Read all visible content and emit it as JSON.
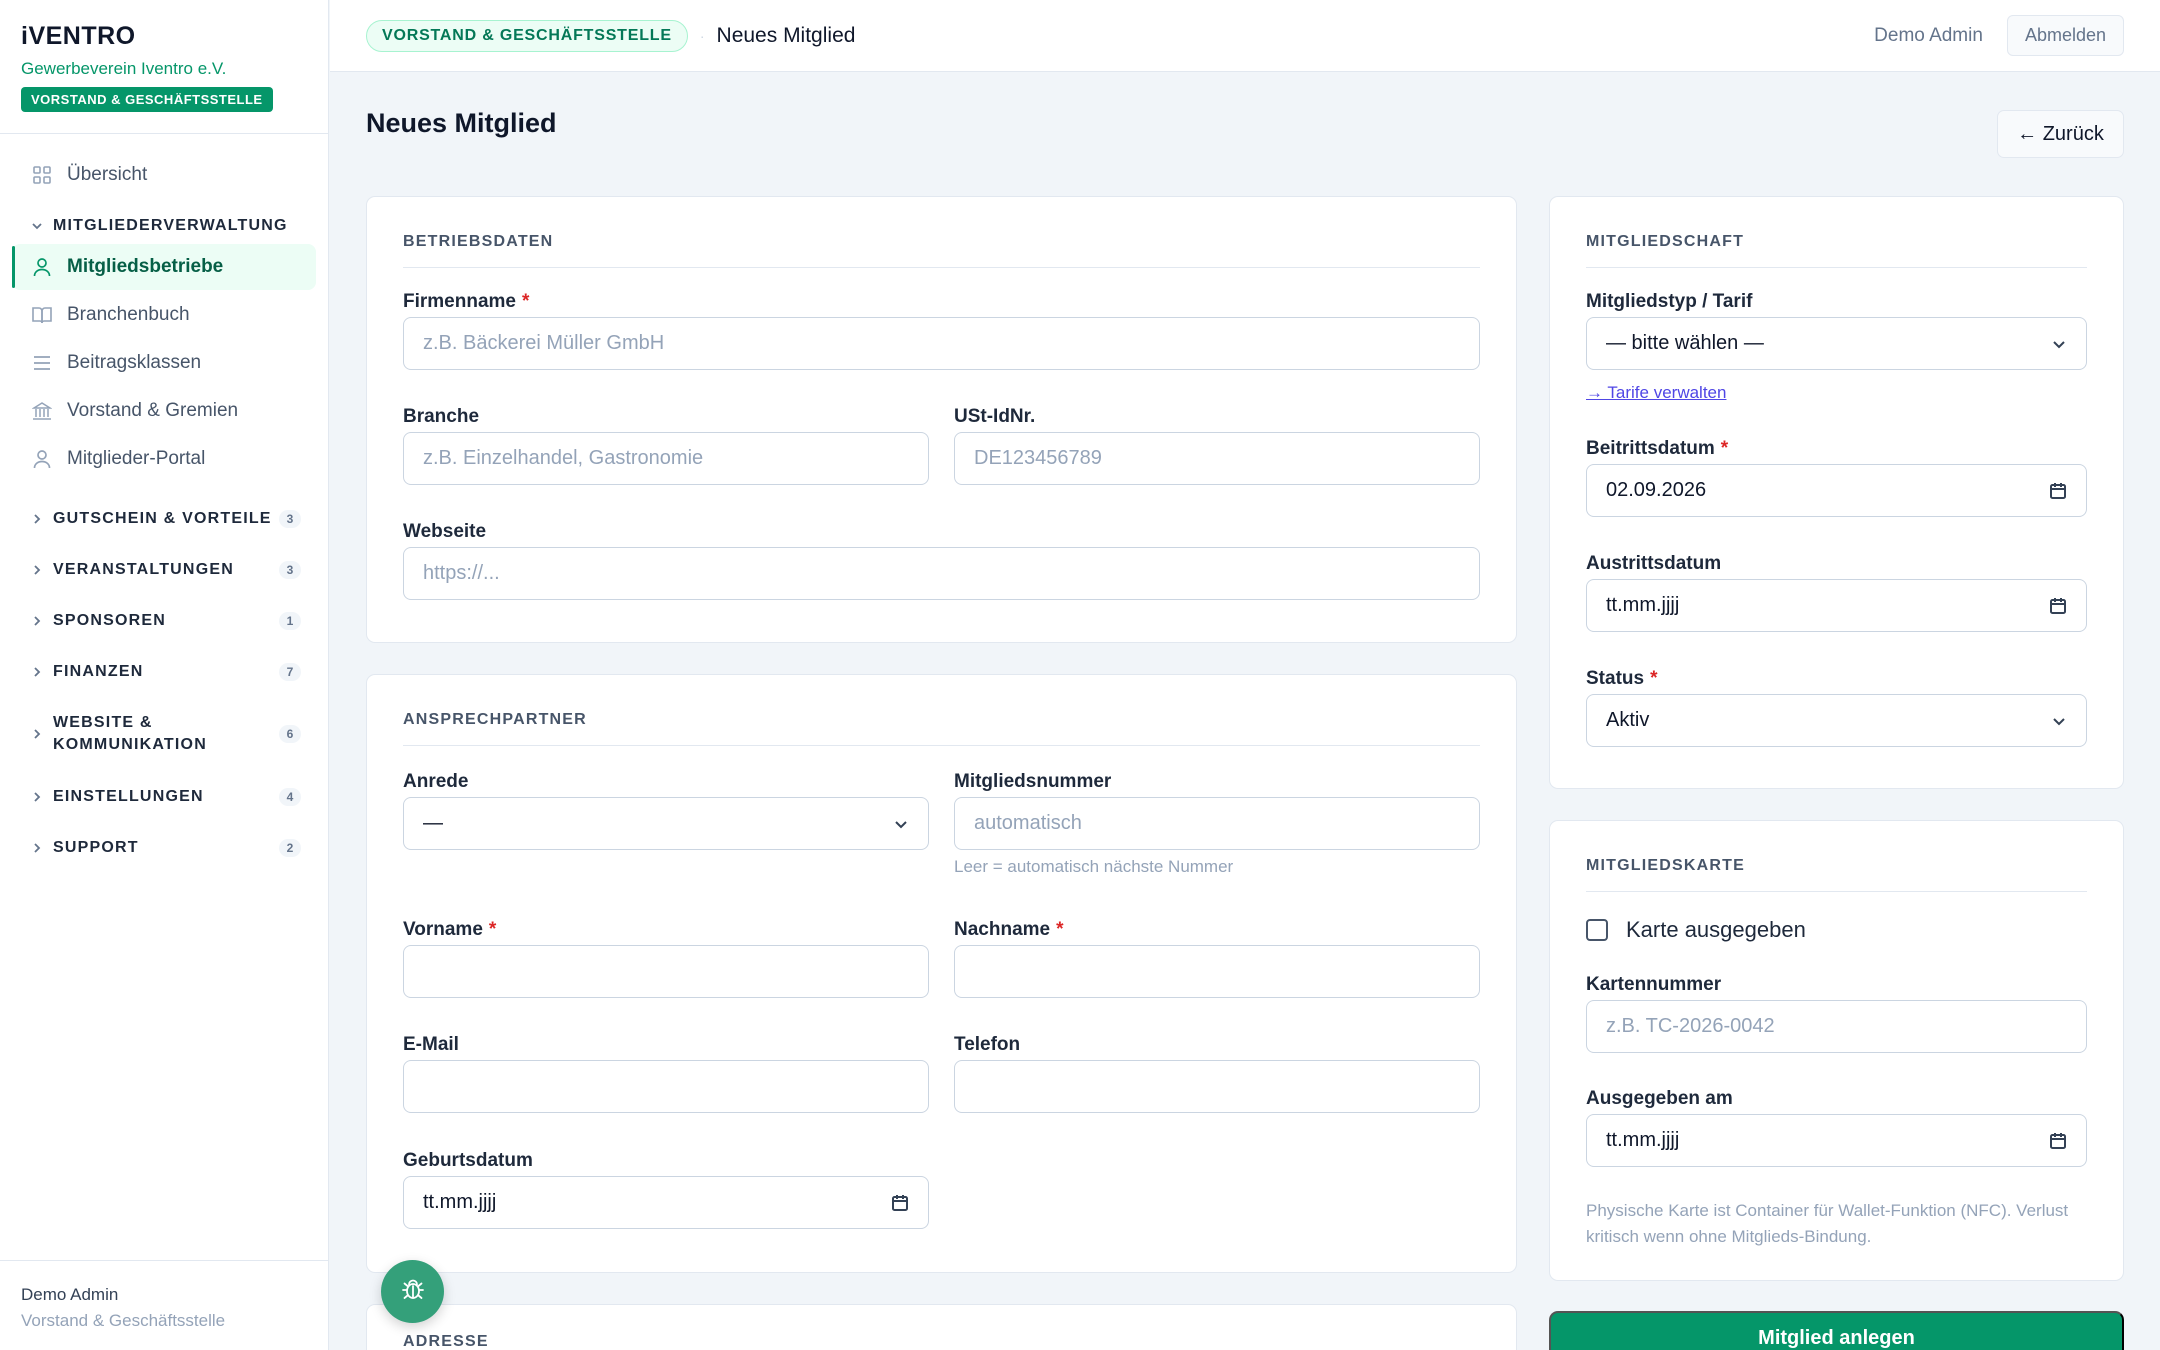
{
  "brand": {
    "logo": "iVENTRO",
    "org": "Gewerbeverein Iventro e.V.",
    "role_badge": "VORSTAND & GESCHÄFTSSTELLE"
  },
  "sidebar": {
    "items": [
      {
        "label": "Übersicht",
        "icon": "grid-icon"
      },
      {
        "label": "Mitgliedsbetriebe",
        "icon": "user-icon"
      },
      {
        "label": "Branchenbuch",
        "icon": "book-icon"
      },
      {
        "label": "Beitragsklassen",
        "icon": "list-icon"
      },
      {
        "label": "Vorstand & Gremien",
        "icon": "building-icon"
      },
      {
        "label": "Mitglieder-Portal",
        "icon": "user-icon"
      }
    ],
    "expanded_group": "MITGLIEDERVERWALTUNG",
    "groups": [
      {
        "label": "GUTSCHEIN & VORTEILE",
        "count": "3"
      },
      {
        "label": "VERANSTALTUNGEN",
        "count": "3"
      },
      {
        "label": "SPONSOREN",
        "count": "1"
      },
      {
        "label": "FINANZEN",
        "count": "7"
      },
      {
        "label": "WEBSITE & KOMMUNIKATION",
        "count": "6"
      },
      {
        "label": "EINSTELLUNGEN",
        "count": "4"
      },
      {
        "label": "SUPPORT",
        "count": "2"
      }
    ],
    "footer": {
      "user": "Demo Admin",
      "role": "Vorstand & Geschäftsstelle"
    }
  },
  "topbar": {
    "badge": "VORSTAND & GESCHÄFTSSTELLE",
    "separator": "·",
    "page": "Neues Mitglied",
    "user": "Demo Admin",
    "logout": "Abmelden"
  },
  "page": {
    "title": "Neues Mitglied",
    "back": "← Zurück"
  },
  "betriebsdaten": {
    "title": "BETRIEBSDATEN",
    "firmenname": {
      "label": "Firmenname",
      "placeholder": "z.B. Bäckerei Müller GmbH",
      "required": "*"
    },
    "branche": {
      "label": "Branche",
      "placeholder": "z.B. Einzelhandel, Gastronomie"
    },
    "ustid": {
      "label": "USt-IdNr.",
      "placeholder": "DE123456789"
    },
    "webseite": {
      "label": "Webseite",
      "placeholder": "https://..."
    }
  },
  "ansprechpartner": {
    "title": "ANSPRECHPARTNER",
    "anrede": {
      "label": "Anrede",
      "value": "—"
    },
    "mitgliedsnummer": {
      "label": "Mitgliedsnummer",
      "placeholder": "automatisch",
      "hint": "Leer = automatisch nächste Nummer"
    },
    "vorname": {
      "label": "Vorname",
      "required": "*"
    },
    "nachname": {
      "label": "Nachname",
      "required": "*"
    },
    "email": {
      "label": "E-Mail"
    },
    "telefon": {
      "label": "Telefon"
    },
    "geburtsdatum": {
      "label": "Geburtsdatum",
      "value": "tt.mm.jjjj"
    }
  },
  "adresse": {
    "title": "ADRESSE"
  },
  "mitgliedschaft": {
    "title": "MITGLIEDSCHAFT",
    "tarif": {
      "label": "Mitgliedstyp / Tarif",
      "value": "— bitte wählen —",
      "link": "→ Tarife verwalten"
    },
    "beitritt": {
      "label": "Beitrittsdatum",
      "value": "02.09.2026",
      "required": "*"
    },
    "austritt": {
      "label": "Austrittsdatum",
      "value": "tt.mm.jjjj"
    },
    "status": {
      "label": "Status",
      "value": "Aktiv",
      "required": "*"
    }
  },
  "mitgliedskarte": {
    "title": "MITGLIEDSKARTE",
    "checkbox": "Karte ausgegeben",
    "kartennummer": {
      "label": "Kartennummer",
      "placeholder": "z.B. TC-2026-0042"
    },
    "ausgegeben": {
      "label": "Ausgegeben am",
      "value": "tt.mm.jjjj"
    },
    "note": "Physische Karte ist Container für Wallet-Funktion (NFC). Verlust kritisch wenn ohne Mitglieds-Bindung."
  },
  "submit": "Mitglied anlegen",
  "colors": {
    "accent": "#059669",
    "link": "#4f46e5",
    "required": "#dc2626"
  }
}
